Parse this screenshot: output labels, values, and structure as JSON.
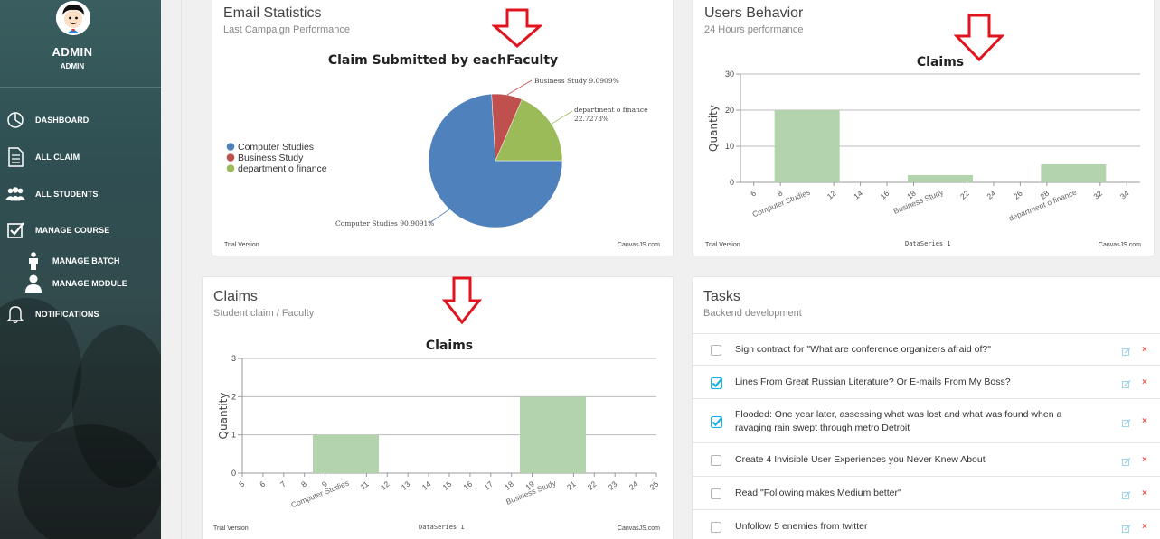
{
  "profile": {
    "name": "ADMIN",
    "role": "ADMIN"
  },
  "nav": [
    {
      "label": "DASHBOARD",
      "icon": "dashboard-pie-icon"
    },
    {
      "label": "ALL CLAIM",
      "icon": "document-icon"
    },
    {
      "label": "ALL STUDENTS",
      "icon": "users-icon"
    },
    {
      "label": "MANAGE COURSE",
      "icon": "checkbox-icon"
    },
    {
      "label": "MANAGE BATCH",
      "icon": "person-icon"
    },
    {
      "label": "MANAGE MODULE",
      "icon": "user-icon"
    },
    {
      "label": "NOTIFICATIONS",
      "icon": "bell-icon"
    }
  ],
  "email_card": {
    "title": "Email Statistics",
    "subtitle": "Last Campaign Performance",
    "footer_left": "Trial Version",
    "footer_right": "CanvasJS.com"
  },
  "users_card": {
    "title": "Users Behavior",
    "subtitle": "24 Hours performance",
    "footer_left": "Trial Version",
    "footer_mid": "DataSeries 1",
    "footer_right": "CanvasJS.com"
  },
  "claims_card": {
    "title": "Claims",
    "subtitle": "Student claim / Faculty",
    "footer_left": "Trial Version",
    "footer_mid": "DataSeries 1",
    "footer_right": "CanvasJS.com"
  },
  "tasks_card": {
    "title": "Tasks",
    "subtitle": "Backend development",
    "items": [
      {
        "text": "Sign contract for \"What are conference organizers afraid of?\"",
        "checked": false
      },
      {
        "text": "Lines From Great Russian Literature? Or E-mails From My Boss?",
        "checked": true
      },
      {
        "text": "Flooded: One year later, assessing what was lost and what was found when a ravaging rain swept through metro Detroit",
        "checked": true
      },
      {
        "text": "Create 4 Invisible User Experiences you Never Knew About",
        "checked": false
      },
      {
        "text": "Read \"Following makes Medium better\"",
        "checked": false
      },
      {
        "text": "Unfollow 5 enemies from twitter",
        "checked": false
      }
    ]
  },
  "colors": {
    "bar": "#b2d3ac",
    "pie_blue": "#4f81bc",
    "pie_red": "#c0504e",
    "pie_green": "#9bbb58",
    "arrow": "#e0141e",
    "check": "#1ab3e8"
  },
  "chart_data": [
    {
      "type": "pie",
      "title": "Claim Submitted by eachFaculty",
      "categories": [
        "Computer Studies",
        "Business Study",
        "department o finance"
      ],
      "values": [
        90.9091,
        9.0909,
        22.7273
      ],
      "labels": [
        "Computer Studies 90.9091%",
        "Business Study 9.0909%",
        "department o finance 22.7273%"
      ],
      "legend": "left"
    },
    {
      "type": "bar",
      "title": "Claims",
      "xlabel": "",
      "ylabel": "Quantity",
      "ylim": [
        0,
        30
      ],
      "yticks": [
        0,
        10,
        20,
        30
      ],
      "xticks": [
        6,
        8,
        12,
        14,
        16,
        18,
        22,
        24,
        26,
        28,
        32,
        34
      ],
      "x_range": [
        5,
        35
      ],
      "categories": [
        "Computer Studies",
        "Business Study",
        "department o finance"
      ],
      "x": [
        10,
        20,
        30
      ],
      "values": [
        20,
        2,
        5
      ],
      "series": [
        {
          "name": "DataSeries 1",
          "values": [
            20,
            2,
            5
          ]
        }
      ],
      "grid": true
    },
    {
      "type": "bar",
      "title": "Claims",
      "xlabel": "",
      "ylabel": "Quantity",
      "ylim": [
        0,
        3
      ],
      "yticks": [
        0,
        1,
        2,
        3
      ],
      "xticks": [
        5,
        6,
        7,
        8,
        9,
        11,
        12,
        13,
        14,
        15,
        16,
        17,
        18,
        19,
        21,
        22,
        23,
        24,
        25
      ],
      "x_range": [
        5,
        25
      ],
      "categories": [
        "Computer Studies",
        "Business Study"
      ],
      "x": [
        10,
        20
      ],
      "values": [
        1,
        2
      ],
      "series": [
        {
          "name": "DataSeries 1",
          "values": [
            1,
            2
          ]
        }
      ],
      "grid": true
    }
  ]
}
